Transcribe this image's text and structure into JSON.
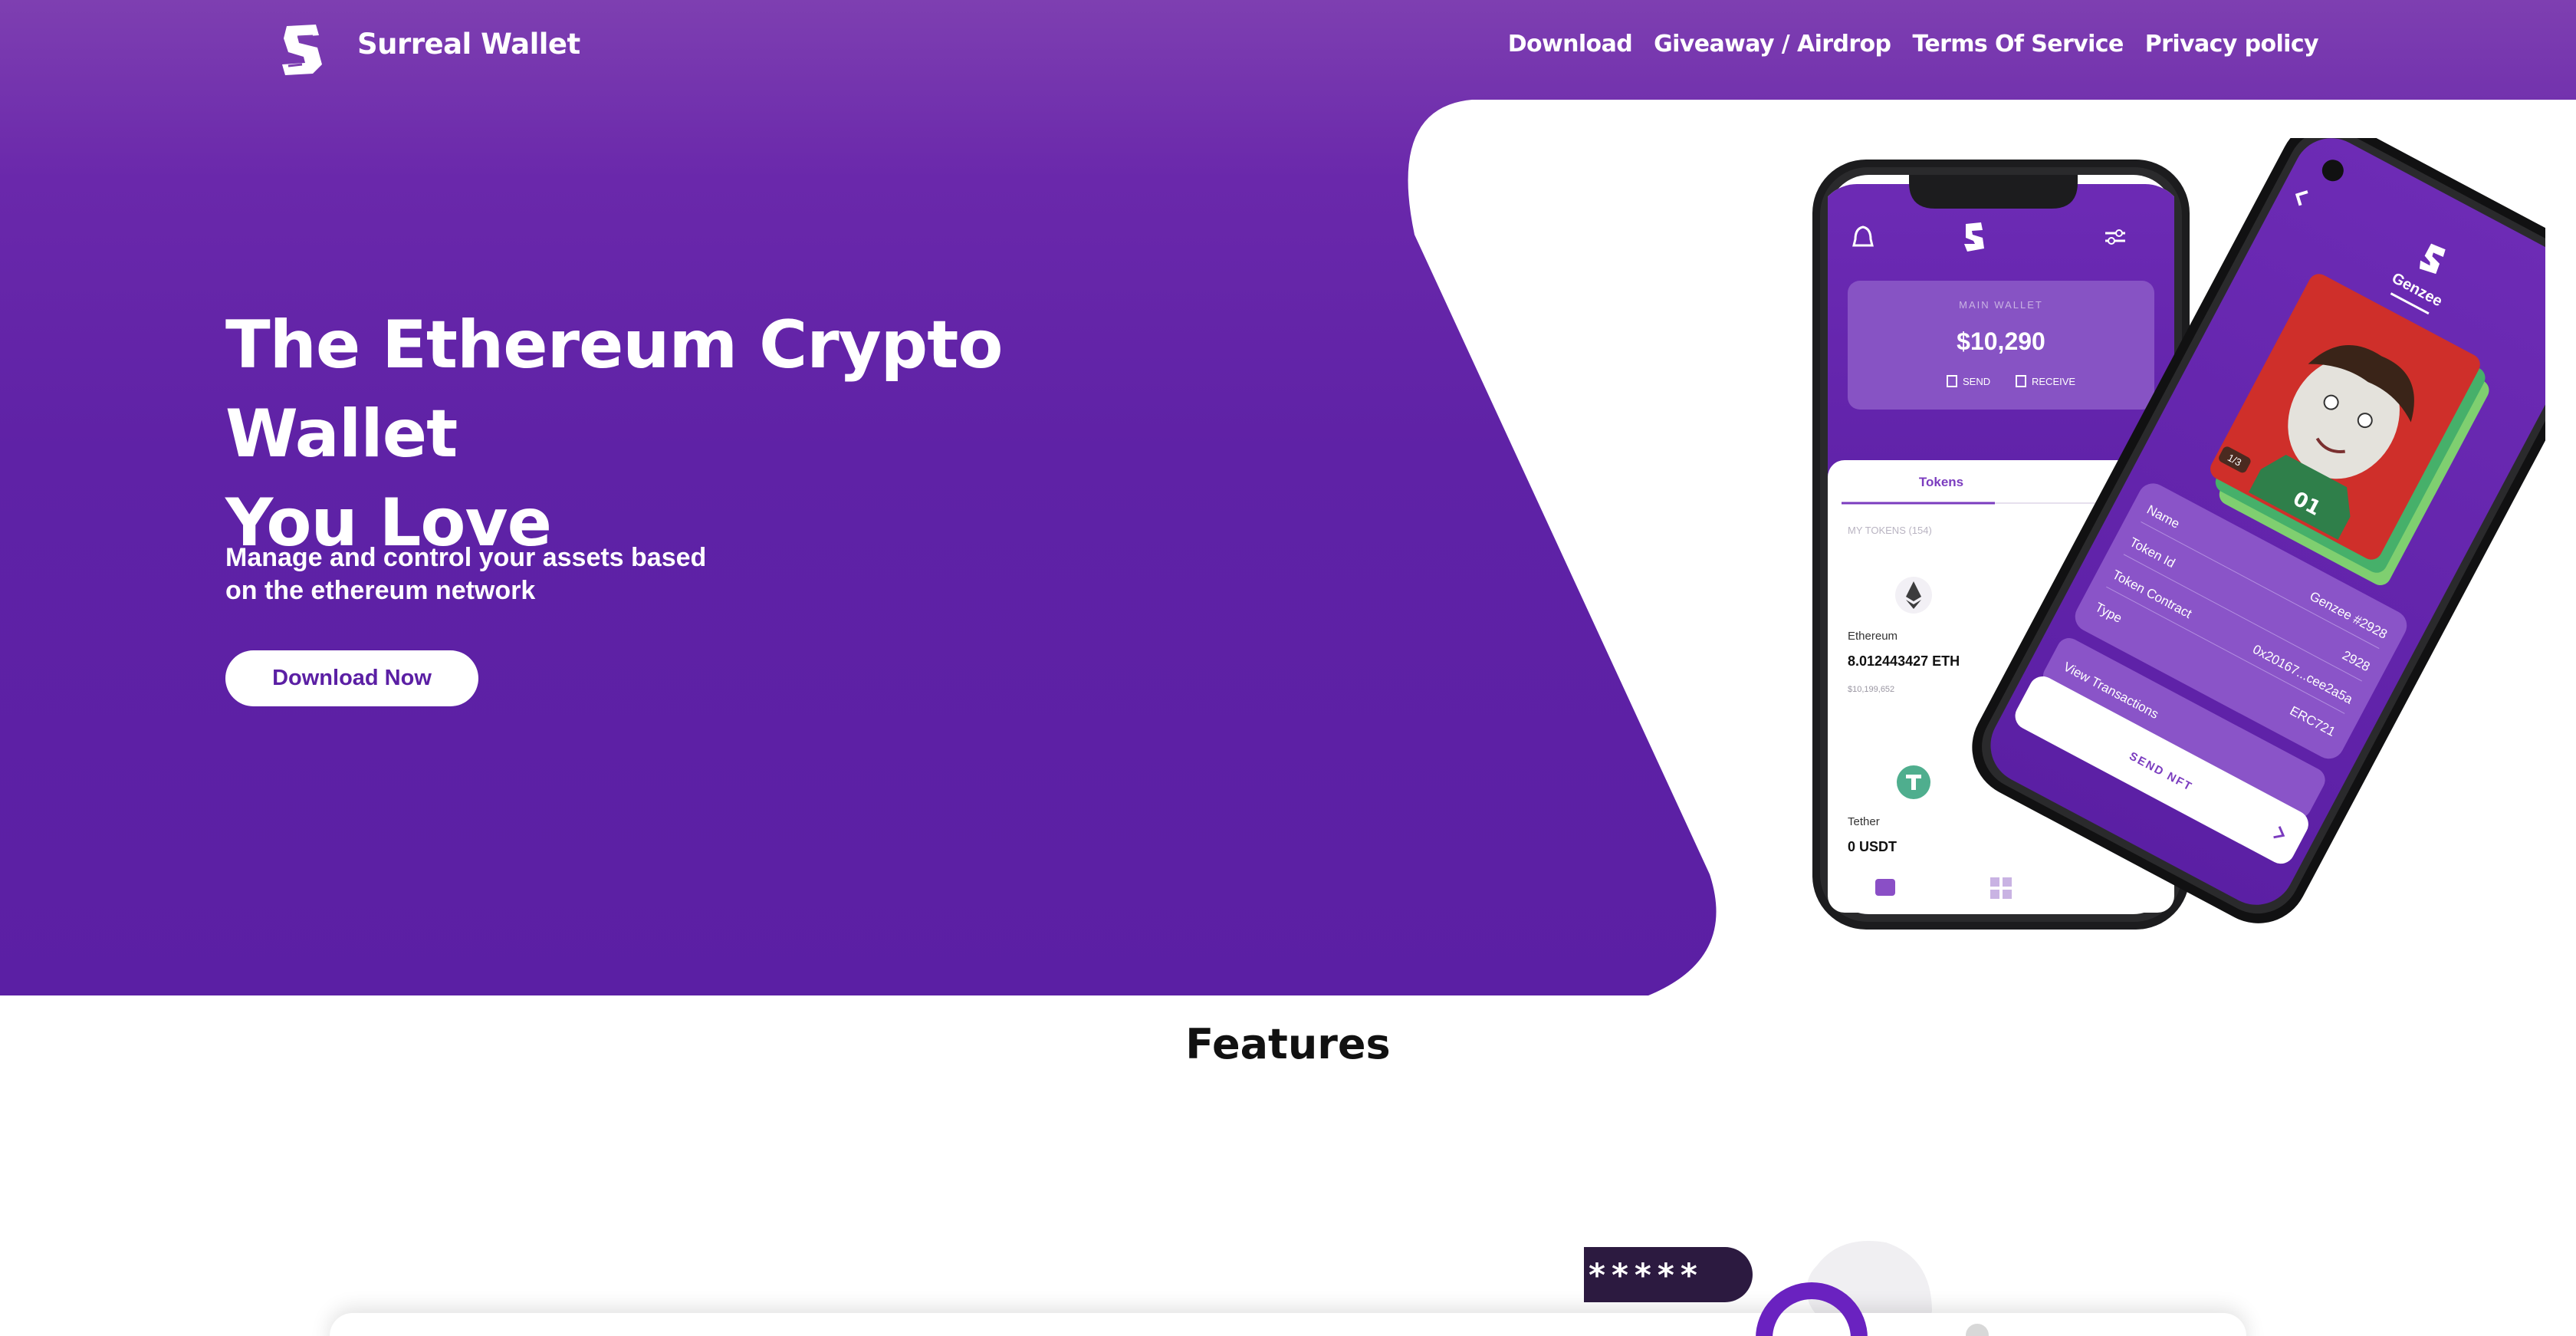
{
  "nav": {
    "brand": "Surreal Wallet",
    "links": [
      "Download",
      "Giveaway / Airdrop",
      "Terms Of Service",
      "Privacy policy"
    ]
  },
  "hero": {
    "title_line1": "The Ethereum Crypto Wallet",
    "title_line2": "You Love",
    "subtitle_line1": "Manage and control your assets based",
    "subtitle_line2": "on the ethereum network",
    "cta": "Download Now"
  },
  "phone_wallet": {
    "main_wallet_label": "MAIN WALLET",
    "balance": "$10,290",
    "send": "SEND",
    "receive": "RECEIVE",
    "tab": "Tokens",
    "my_tokens": "MY TOKENS (154)",
    "token1_name": "Ethereum",
    "token1_amount": "8.012443427 ETH",
    "token1_value": "$10,199,652",
    "token2_name": "Tether",
    "token2_amount": "0 USDT"
  },
  "phone_nft": {
    "title": "Genzee",
    "counter": "1/3",
    "rows": [
      {
        "label": "Name",
        "value": "Genzee #2928"
      },
      {
        "label": "Token Id",
        "value": "2928"
      },
      {
        "label": "Token Contract",
        "value": "0x20167...cee2a5a"
      },
      {
        "label": "Type",
        "value": "ERC721"
      }
    ],
    "view_transactions": "View Transactions",
    "send_nft": "SEND NFT"
  },
  "features": {
    "title": "Features",
    "password_mask": "*****"
  },
  "colors": {
    "brand_purple": "#5b1fa4",
    "nav_purple": "#7e3fb1",
    "white": "#ffffff"
  }
}
